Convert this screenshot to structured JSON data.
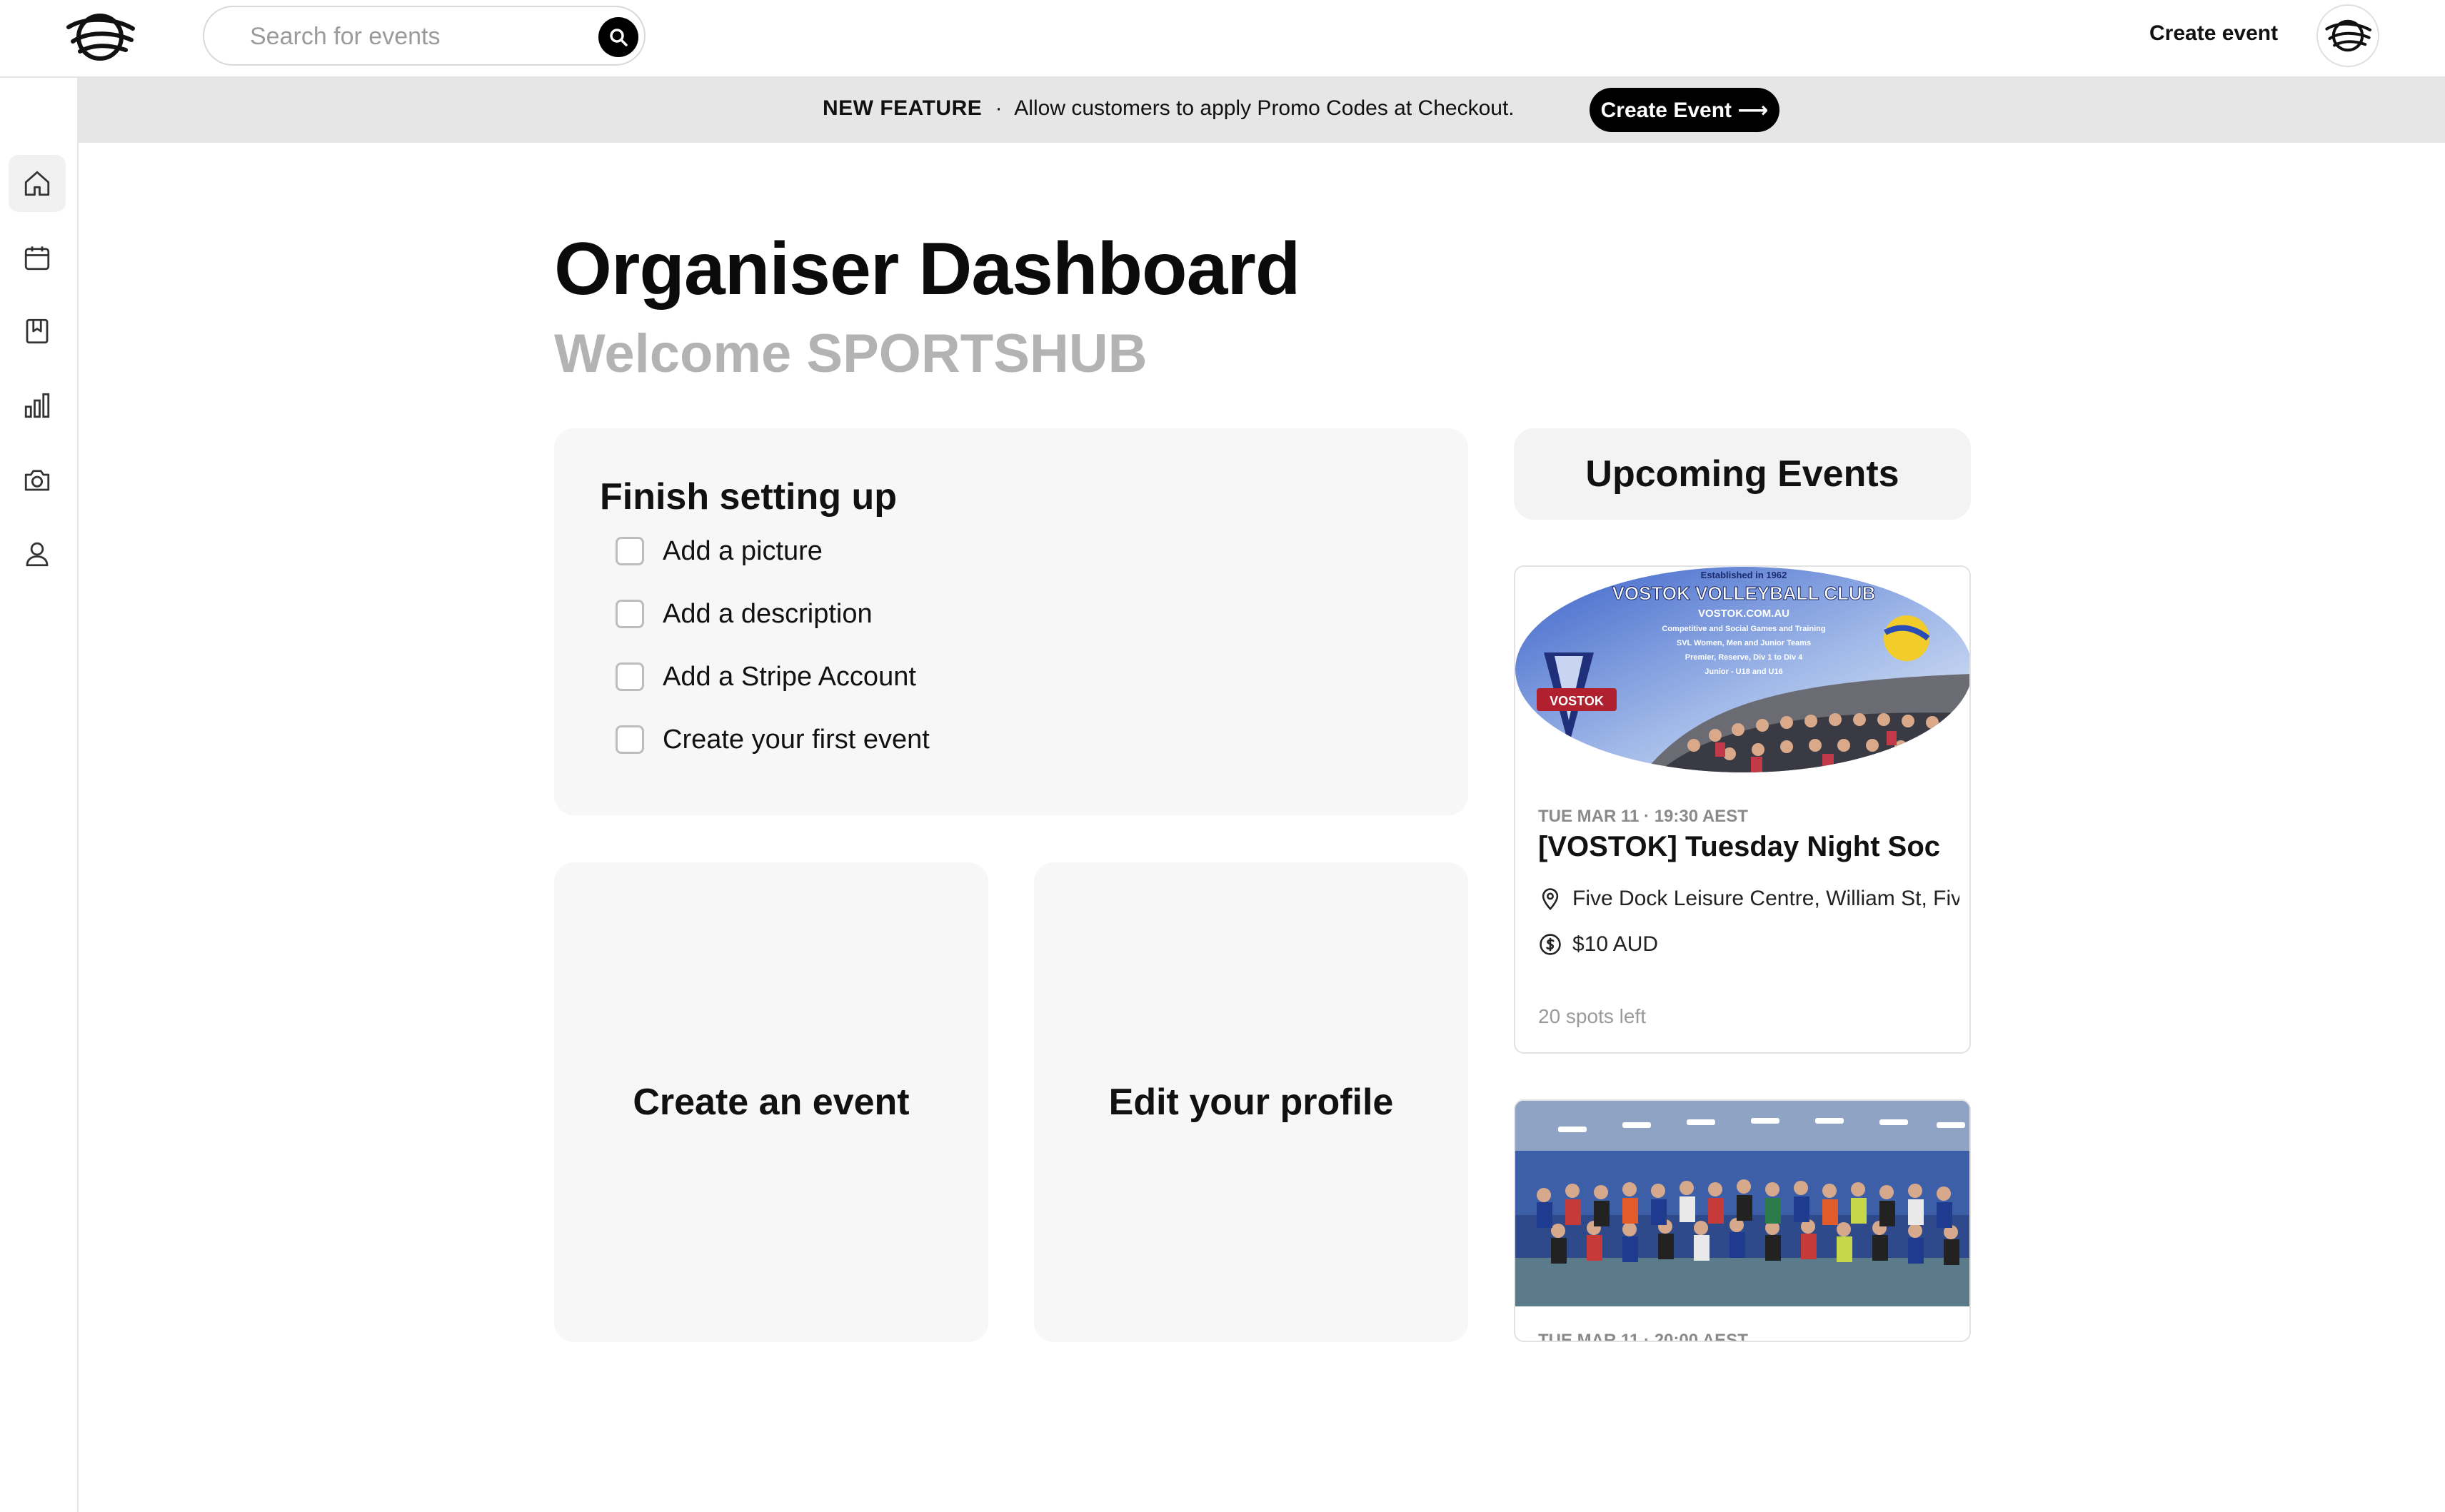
{
  "header": {
    "search_placeholder": "Search for events",
    "create_event_label": "Create event"
  },
  "sidebar": {
    "items": [
      {
        "name": "home",
        "icon": "home-icon",
        "active": true
      },
      {
        "name": "calendar",
        "icon": "calendar-icon",
        "active": false
      },
      {
        "name": "bookmarks",
        "icon": "bookmark-icon",
        "active": false
      },
      {
        "name": "analytics",
        "icon": "bar-chart-icon",
        "active": false
      },
      {
        "name": "gallery",
        "icon": "camera-icon",
        "active": false
      },
      {
        "name": "profile",
        "icon": "user-icon",
        "active": false
      }
    ]
  },
  "banner": {
    "tag": "NEW FEATURE",
    "separator": "·",
    "message": "Allow customers to apply Promo Codes at Checkout.",
    "button_label": "Create Event ⟶"
  },
  "main": {
    "title": "Organiser Dashboard",
    "welcome": "Welcome SPORTSHUB"
  },
  "setup": {
    "title": "Finish setting up",
    "items": [
      {
        "label": "Add a picture",
        "checked": false
      },
      {
        "label": "Add a description",
        "checked": false
      },
      {
        "label": "Add a Stripe Account",
        "checked": false
      },
      {
        "label": "Create your first event",
        "checked": false
      }
    ]
  },
  "actions": {
    "create_event": "Create an event",
    "edit_profile": "Edit your profile"
  },
  "upcoming": {
    "title": "Upcoming Events",
    "events": [
      {
        "meta": "TUE MAR 11 · 19:30 AEST",
        "title": "[VOSTOK] Tuesday Night Soc",
        "location": "Five Dock Leisure Centre, William St, Fiv",
        "price": "$10 AUD",
        "spots": "20 spots left",
        "image": {
          "line1": "Established in 1962",
          "line2": "VOSTOK VOLLEYBALL CLUB",
          "line3": "VOSTOK.COM.AU",
          "line4": "Competitive and Social Games and Training",
          "line5": "SVL Women, Men and Junior Teams",
          "line6": "Premier, Reserve, Div 1 to Div 4",
          "line7": "Junior - U18 and U16",
          "badge": "VOSTOK"
        }
      },
      {
        "meta": "TUE MAR 11 · 20:00 AEST"
      }
    ]
  },
  "colors": {
    "accent": "#000000",
    "banner_bg": "#e6e6e6",
    "card_bg": "#f7f7f7",
    "muted_text": "#b3b3b3"
  }
}
